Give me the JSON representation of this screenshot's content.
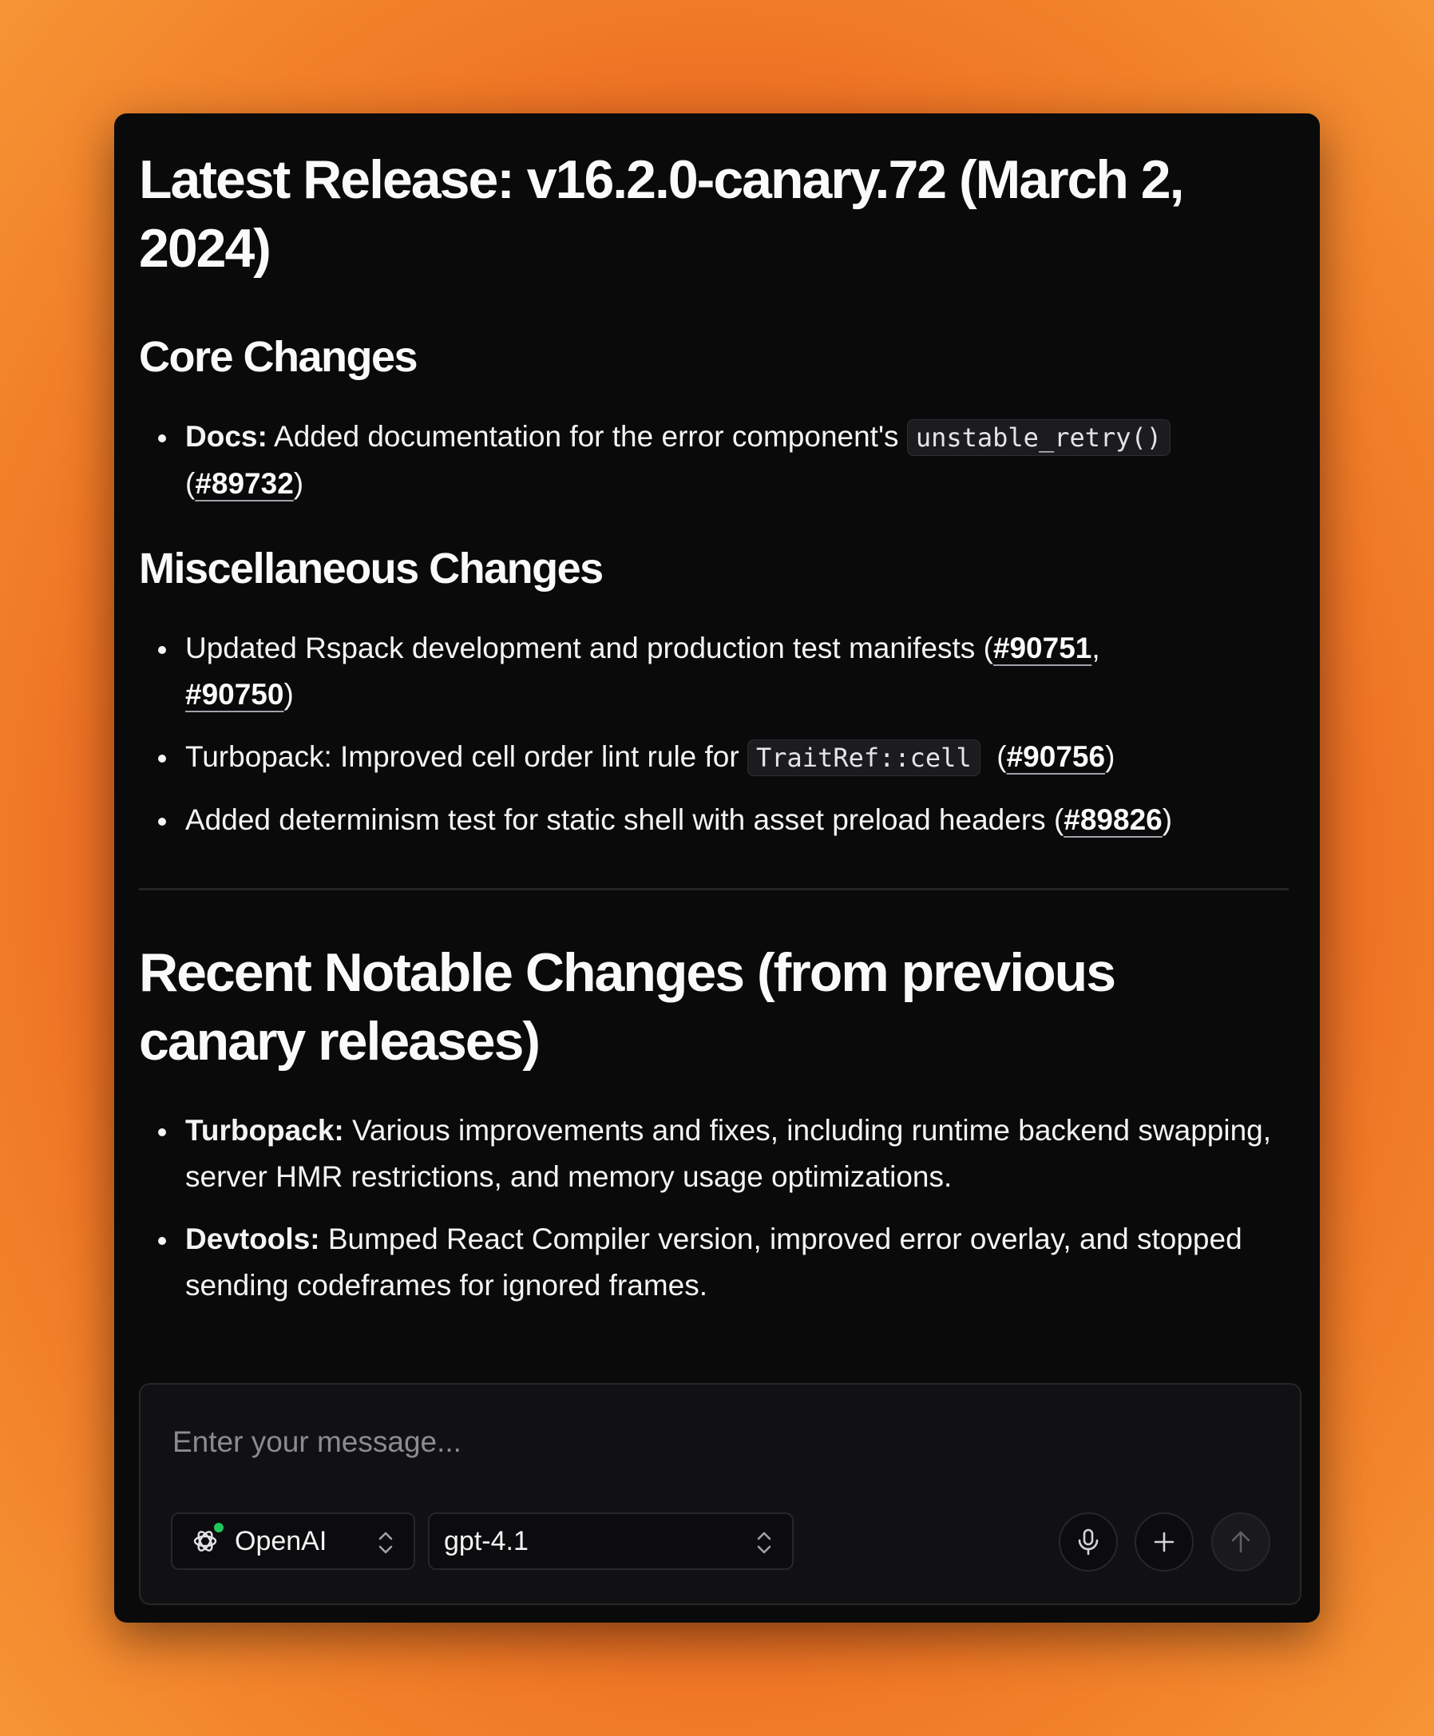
{
  "release": {
    "title": "Latest Release: v16.2.0-canary.72 (March 2, 2024)",
    "core": {
      "heading": "Core Changes",
      "items": [
        {
          "label": "Docs:",
          "text": " Added documentation for the error component's ",
          "code": "unstable_retry()",
          "prs": [
            "#89732"
          ]
        }
      ]
    },
    "misc": {
      "heading": "Miscellaneous Changes",
      "items": [
        {
          "text": "Updated Rspack development and production test manifests ",
          "prs": [
            "#90751",
            "#90750"
          ]
        },
        {
          "text": "Turbopack: Improved cell order lint rule for ",
          "code": "TraitRef::cell",
          "prs": [
            "#90756"
          ]
        },
        {
          "text": "Added determinism test for static shell with asset preload headers ",
          "prs": [
            "#89826"
          ]
        }
      ]
    }
  },
  "recent": {
    "heading": "Recent Notable Changes (from previous canary releases)",
    "items": [
      {
        "label": "Turbopack:",
        "text": " Various improvements and fixes, including runtime backend swapping, server HMR restrictions, and memory usage optimizations."
      },
      {
        "label": "Devtools:",
        "text": " Bumped React Compiler version, improved error overlay, and stopped sending codeframes for ignored frames."
      }
    ]
  },
  "composer": {
    "placeholder": "Enter your message...",
    "value": "",
    "provider": {
      "label": "OpenAI",
      "icon": "openai-logo-icon",
      "status_color": "#22c55e"
    },
    "model": {
      "label": "gpt-4.1"
    },
    "buttons": {
      "mic_icon": "microphone-icon",
      "attach_icon": "plus-icon",
      "send_icon": "arrow-up-icon"
    }
  }
}
